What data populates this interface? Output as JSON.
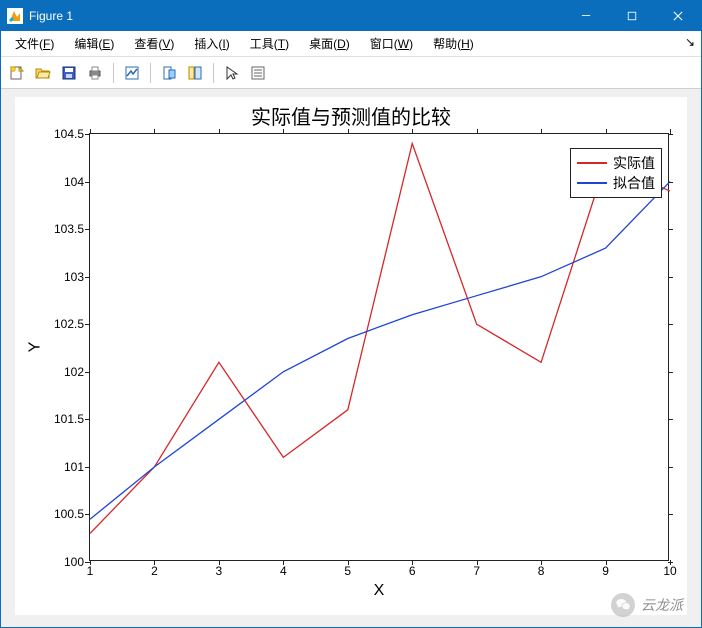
{
  "window": {
    "title": "Figure 1"
  },
  "menu": {
    "items": [
      {
        "label": "文件",
        "accel": "F"
      },
      {
        "label": "编辑",
        "accel": "E"
      },
      {
        "label": "查看",
        "accel": "V"
      },
      {
        "label": "插入",
        "accel": "I"
      },
      {
        "label": "工具",
        "accel": "T"
      },
      {
        "label": "桌面",
        "accel": "D"
      },
      {
        "label": "窗口",
        "accel": "W"
      },
      {
        "label": "帮助",
        "accel": "H"
      }
    ]
  },
  "chart_data": {
    "type": "line",
    "title": "实际值与预测值的比较",
    "xlabel": "X",
    "ylabel": "Y",
    "x": [
      1,
      2,
      3,
      4,
      5,
      6,
      7,
      8,
      9,
      10
    ],
    "series": [
      {
        "name": "实际值",
        "color": "#d62728",
        "values": [
          100.3,
          101.0,
          102.1,
          101.1,
          101.6,
          104.4,
          102.5,
          102.1,
          104.2,
          103.9
        ]
      },
      {
        "name": "拟合值",
        "color": "#1f45d8",
        "values": [
          100.45,
          101.0,
          101.5,
          102.0,
          102.35,
          102.6,
          102.8,
          103.0,
          103.3,
          104.0
        ]
      }
    ],
    "xlim": [
      1,
      10
    ],
    "ylim": [
      100,
      104.5
    ],
    "xticks": [
      1,
      2,
      3,
      4,
      5,
      6,
      7,
      8,
      9,
      10
    ],
    "yticks": [
      100,
      100.5,
      101,
      101.5,
      102,
      102.5,
      103,
      103.5,
      104,
      104.5
    ],
    "legend_pos": "top-right"
  },
  "watermark": {
    "text": "云龙派"
  }
}
